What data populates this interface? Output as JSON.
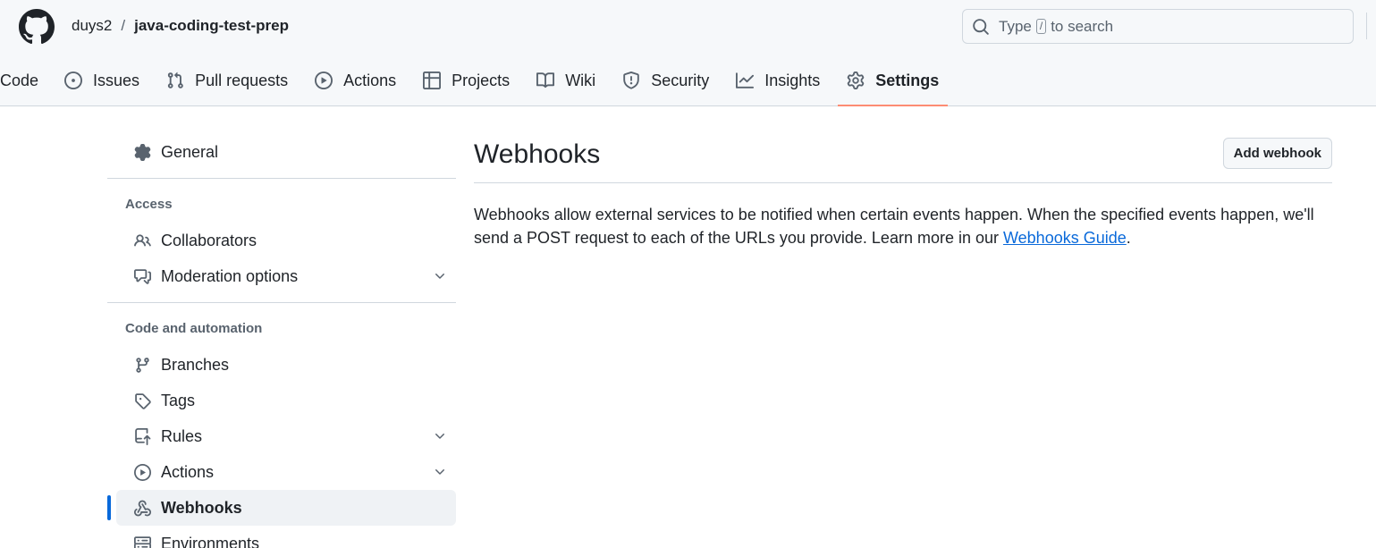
{
  "header": {
    "owner": "duys2",
    "separator": "/",
    "repo": "java-coding-test-prep",
    "search": {
      "before": "Type",
      "key": "/",
      "after": "to search"
    }
  },
  "tabs": [
    {
      "label": "Code",
      "icon": "code-icon"
    },
    {
      "label": "Issues",
      "icon": "issue-icon"
    },
    {
      "label": "Pull requests",
      "icon": "pull-request-icon"
    },
    {
      "label": "Actions",
      "icon": "play-icon"
    },
    {
      "label": "Projects",
      "icon": "table-icon"
    },
    {
      "label": "Wiki",
      "icon": "book-icon"
    },
    {
      "label": "Security",
      "icon": "shield-icon"
    },
    {
      "label": "Insights",
      "icon": "graph-icon"
    },
    {
      "label": "Settings",
      "icon": "gear-icon",
      "active": true
    }
  ],
  "sidebar": {
    "general": "General",
    "access_heading": "Access",
    "collaborators": "Collaborators",
    "moderation": "Moderation options",
    "code_heading": "Code and automation",
    "branches": "Branches",
    "tags": "Tags",
    "rules": "Rules",
    "actions": "Actions",
    "webhooks": "Webhooks",
    "environments": "Environments"
  },
  "main": {
    "title": "Webhooks",
    "add_button": "Add webhook",
    "description": "Webhooks allow external services to be notified when certain events happen. When the specified events happen, we'll send a POST request to each of the URLs you provide. Learn more in our ",
    "link": "Webhooks Guide",
    "period": "."
  },
  "colors": {
    "accent": "#0969da",
    "tab_underline": "#fd8c73",
    "border": "#d0d7de"
  }
}
